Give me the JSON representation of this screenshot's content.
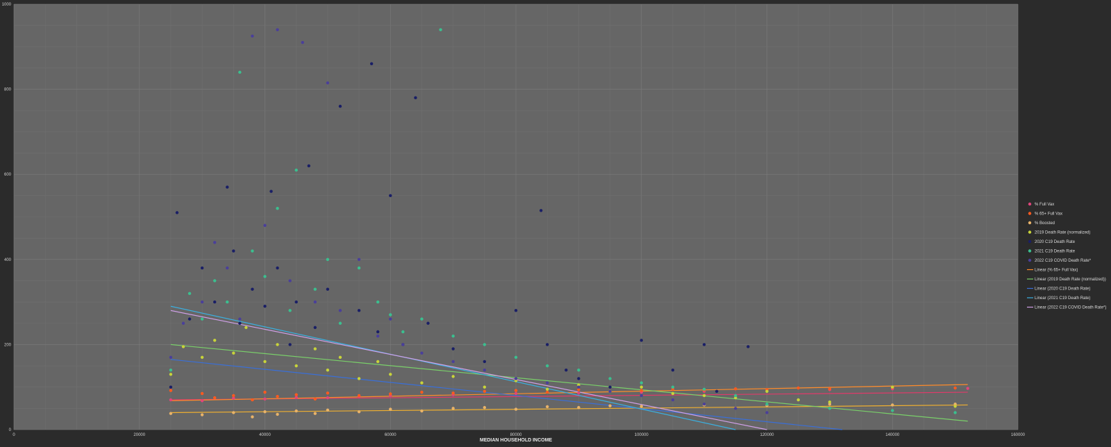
{
  "chart_data": {
    "type": "scatter",
    "title": "",
    "xlabel": "MEDIAN HOUSEHOLD INCOME",
    "ylabel": "",
    "xlim": [
      0,
      160000
    ],
    "ylim": [
      0,
      1000
    ],
    "x_ticks": [
      "0",
      "20000",
      "40000",
      "60000",
      "80000",
      "100000",
      "120000",
      "140000",
      "160000"
    ],
    "y_ticks": [
      "0",
      "200",
      "400",
      "600",
      "800",
      "1000"
    ],
    "grid": true,
    "legend_position": "right",
    "background": "#666666",
    "series": [
      {
        "name": "% Full Vax",
        "color": "#e0457b",
        "points": [
          [
            25000,
            70
          ],
          [
            30000,
            68
          ],
          [
            35000,
            74
          ],
          [
            40000,
            72
          ],
          [
            45000,
            76
          ],
          [
            50000,
            75
          ],
          [
            55000,
            78
          ],
          [
            60000,
            80
          ],
          [
            70000,
            82
          ],
          [
            80000,
            85
          ],
          [
            90000,
            86
          ],
          [
            100000,
            88
          ],
          [
            110000,
            90
          ],
          [
            120000,
            92
          ],
          [
            130000,
            94
          ],
          [
            140000,
            96
          ],
          [
            152000,
            97
          ]
        ]
      },
      {
        "name": "% 65+ Full Vax",
        "color": "#ff5a1f",
        "points": [
          [
            25000,
            92
          ],
          [
            30000,
            85
          ],
          [
            32000,
            75
          ],
          [
            35000,
            80
          ],
          [
            38000,
            70
          ],
          [
            40000,
            88
          ],
          [
            42000,
            78
          ],
          [
            45000,
            82
          ],
          [
            48000,
            72
          ],
          [
            50000,
            86
          ],
          [
            55000,
            80
          ],
          [
            60000,
            84
          ],
          [
            65000,
            88
          ],
          [
            70000,
            86
          ],
          [
            75000,
            90
          ],
          [
            80000,
            92
          ],
          [
            85000,
            88
          ],
          [
            90000,
            94
          ],
          [
            95000,
            90
          ],
          [
            100000,
            92
          ],
          [
            105000,
            95
          ],
          [
            110000,
            93
          ],
          [
            115000,
            96
          ],
          [
            120000,
            94
          ],
          [
            125000,
            98
          ],
          [
            130000,
            96
          ],
          [
            140000,
            99
          ],
          [
            150000,
            98
          ]
        ]
      },
      {
        "name": "% Boosted",
        "color": "#e8b36a",
        "points": [
          [
            25000,
            38
          ],
          [
            30000,
            35
          ],
          [
            35000,
            40
          ],
          [
            38000,
            30
          ],
          [
            40000,
            42
          ],
          [
            42000,
            36
          ],
          [
            45000,
            44
          ],
          [
            48000,
            38
          ],
          [
            50000,
            46
          ],
          [
            55000,
            42
          ],
          [
            60000,
            48
          ],
          [
            65000,
            44
          ],
          [
            70000,
            50
          ],
          [
            75000,
            52
          ],
          [
            80000,
            48
          ],
          [
            85000,
            54
          ],
          [
            90000,
            52
          ],
          [
            95000,
            56
          ],
          [
            100000,
            55
          ],
          [
            110000,
            58
          ],
          [
            120000,
            57
          ],
          [
            130000,
            60
          ],
          [
            140000,
            58
          ],
          [
            150000,
            60
          ]
        ]
      },
      {
        "name": "2019 Death Rate (normalized)",
        "color": "#c8d43a",
        "points": [
          [
            25000,
            130
          ],
          [
            27000,
            195
          ],
          [
            30000,
            170
          ],
          [
            32000,
            210
          ],
          [
            35000,
            180
          ],
          [
            37000,
            240
          ],
          [
            40000,
            160
          ],
          [
            42000,
            200
          ],
          [
            45000,
            150
          ],
          [
            48000,
            190
          ],
          [
            50000,
            140
          ],
          [
            52000,
            170
          ],
          [
            55000,
            120
          ],
          [
            58000,
            160
          ],
          [
            60000,
            130
          ],
          [
            65000,
            110
          ],
          [
            70000,
            125
          ],
          [
            75000,
            100
          ],
          [
            80000,
            115
          ],
          [
            85000,
            95
          ],
          [
            90000,
            105
          ],
          [
            95000,
            90
          ],
          [
            100000,
            100
          ],
          [
            105000,
            85
          ],
          [
            110000,
            80
          ],
          [
            115000,
            75
          ],
          [
            120000,
            90
          ],
          [
            125000,
            70
          ],
          [
            130000,
            65
          ],
          [
            140000,
            100
          ],
          [
            150000,
            55
          ]
        ]
      },
      {
        "name": "2020 C19 Death Rate",
        "color": "#1a1f66",
        "points": [
          [
            25000,
            100
          ],
          [
            26000,
            510
          ],
          [
            28000,
            260
          ],
          [
            30000,
            380
          ],
          [
            32000,
            300
          ],
          [
            34000,
            570
          ],
          [
            35000,
            420
          ],
          [
            36000,
            250
          ],
          [
            38000,
            330
          ],
          [
            40000,
            290
          ],
          [
            41000,
            560
          ],
          [
            42000,
            380
          ],
          [
            44000,
            200
          ],
          [
            45000,
            300
          ],
          [
            47000,
            620
          ],
          [
            48000,
            240
          ],
          [
            50000,
            330
          ],
          [
            52000,
            760
          ],
          [
            55000,
            280
          ],
          [
            57000,
            860
          ],
          [
            58000,
            230
          ],
          [
            60000,
            550
          ],
          [
            62000,
            200
          ],
          [
            64000,
            780
          ],
          [
            66000,
            250
          ],
          [
            70000,
            190
          ],
          [
            75000,
            160
          ],
          [
            80000,
            280
          ],
          [
            84000,
            515
          ],
          [
            85000,
            200
          ],
          [
            88000,
            140
          ],
          [
            90000,
            120
          ],
          [
            95000,
            100
          ],
          [
            100000,
            210
          ],
          [
            105000,
            140
          ],
          [
            110000,
            200
          ],
          [
            112000,
            90
          ],
          [
            117000,
            195
          ],
          [
            120000,
            60
          ]
        ]
      },
      {
        "name": "2021 C19 Death Rate",
        "color": "#3bbf8f",
        "points": [
          [
            25000,
            140
          ],
          [
            28000,
            320
          ],
          [
            30000,
            260
          ],
          [
            32000,
            350
          ],
          [
            34000,
            300
          ],
          [
            36000,
            840
          ],
          [
            38000,
            420
          ],
          [
            40000,
            360
          ],
          [
            42000,
            520
          ],
          [
            44000,
            280
          ],
          [
            45000,
            610
          ],
          [
            48000,
            330
          ],
          [
            50000,
            400
          ],
          [
            52000,
            250
          ],
          [
            55000,
            380
          ],
          [
            58000,
            300
          ],
          [
            60000,
            270
          ],
          [
            62000,
            230
          ],
          [
            65000,
            260
          ],
          [
            68000,
            940
          ],
          [
            70000,
            220
          ],
          [
            75000,
            200
          ],
          [
            80000,
            170
          ],
          [
            85000,
            150
          ],
          [
            90000,
            140
          ],
          [
            95000,
            120
          ],
          [
            100000,
            110
          ],
          [
            105000,
            100
          ],
          [
            110000,
            95
          ],
          [
            115000,
            80
          ],
          [
            120000,
            60
          ],
          [
            130000,
            50
          ],
          [
            140000,
            45
          ],
          [
            150000,
            40
          ]
        ]
      },
      {
        "name": "2022 C19 COVID Death Rate*",
        "color": "#4a3f9a",
        "points": [
          [
            25000,
            170
          ],
          [
            27000,
            250
          ],
          [
            30000,
            300
          ],
          [
            32000,
            440
          ],
          [
            34000,
            380
          ],
          [
            36000,
            260
          ],
          [
            38000,
            925
          ],
          [
            40000,
            480
          ],
          [
            42000,
            940
          ],
          [
            44000,
            350
          ],
          [
            46000,
            910
          ],
          [
            48000,
            300
          ],
          [
            50000,
            815
          ],
          [
            52000,
            280
          ],
          [
            55000,
            400
          ],
          [
            58000,
            220
          ],
          [
            60000,
            260
          ],
          [
            62000,
            200
          ],
          [
            65000,
            180
          ],
          [
            70000,
            160
          ],
          [
            75000,
            140
          ],
          [
            80000,
            120
          ],
          [
            85000,
            110
          ],
          [
            90000,
            100
          ],
          [
            95000,
            90
          ],
          [
            100000,
            80
          ],
          [
            105000,
            70
          ],
          [
            110000,
            60
          ],
          [
            115000,
            50
          ],
          [
            120000,
            40
          ]
        ]
      }
    ],
    "trendlines": [
      {
        "name": "Linear (% 65+ Full Vax)",
        "color": "#ff8c2a",
        "x": [
          25000,
          152000
        ],
        "y": [
          68,
          106
        ]
      },
      {
        "name": "Linear (2019 Death Rate (normalized))",
        "color": "#7ad06a",
        "x": [
          25000,
          152000
        ],
        "y": [
          200,
          20
        ]
      },
      {
        "name": "Linear (2020 C19 Death Rate)",
        "color": "#3a6fd8",
        "x": [
          25000,
          132000
        ],
        "y": [
          165,
          0
        ]
      },
      {
        "name": "Linear (2021 C19 Death Rate)",
        "color": "#3bb0e0",
        "x": [
          25000,
          115000
        ],
        "y": [
          290,
          0
        ]
      },
      {
        "name": "Linear (2022 C19 COVID Death Rate*)",
        "color": "#d0a0e8",
        "x": [
          25000,
          120000
        ],
        "y": [
          280,
          0
        ]
      }
    ],
    "extra_lines": [
      {
        "color": "#e03a6a",
        "x": [
          25000,
          152000
        ],
        "y": [
          70,
          88
        ]
      },
      {
        "color": "#f0b030",
        "x": [
          25000,
          152000
        ],
        "y": [
          40,
          58
        ]
      }
    ]
  }
}
